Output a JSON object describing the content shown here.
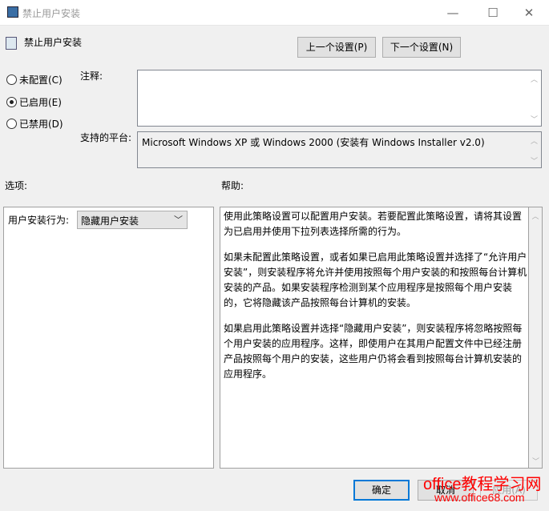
{
  "window": {
    "title": "禁止用户安装",
    "minimize_icon": "minimize-icon",
    "maximize_icon": "maximize-icon",
    "close_icon": "close-icon"
  },
  "header": {
    "policy_name": "禁止用户安装",
    "prev_button": "上一个设置(P)",
    "next_button": "下一个设置(N)"
  },
  "state": {
    "options": [
      {
        "label": "未配置(C)",
        "selected": false
      },
      {
        "label": "已启用(E)",
        "selected": true
      },
      {
        "label": "已禁用(D)",
        "selected": false
      }
    ]
  },
  "comment": {
    "label": "注释:",
    "value": ""
  },
  "platform": {
    "label": "支持的平台:",
    "value": "Microsoft Windows XP 或 Windows 2000 (安装有 Windows Installer v2.0)"
  },
  "options_panel": {
    "label": "选项:",
    "field_label": "用户安装行为:",
    "field_value": "隐藏用户安装"
  },
  "help_panel": {
    "label": "帮助:",
    "paragraphs": [
      "使用此策略设置可以配置用户安装。若要配置此策略设置，请将其设置为已启用并使用下拉列表选择所需的行为。",
      "如果未配置此策略设置，或者如果已启用此策略设置并选择了“允许用户安装”，则安装程序将允许并使用按照每个用户安装的和按照每台计算机安装的产品。如果安装程序检测到某个应用程序是按照每个用户安装的，它将隐藏该产品按照每台计算机的安装。",
      "如果启用此策略设置并选择“隐藏用户安装”，则安装程序将忽略按照每个用户安装的应用程序。这样，即使用户在其用户配置文件中已经注册产品按照每个用户的安装，这些用户仍将会看到按照每台计算机安装的应用程序。"
    ]
  },
  "footer": {
    "ok": "确定",
    "cancel": "取消",
    "apply": "应用(A)"
  },
  "watermark": {
    "line1": "office教程学习网",
    "line2": "www.office68.com"
  }
}
